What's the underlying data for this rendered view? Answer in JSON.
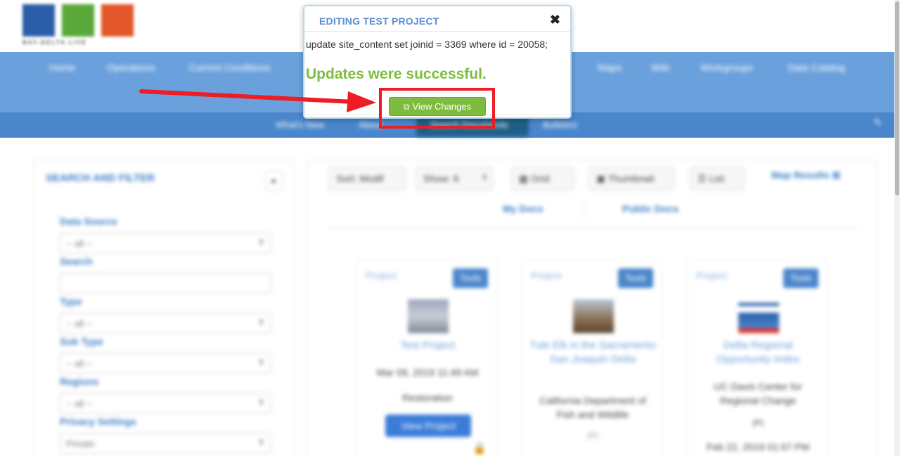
{
  "logo": {
    "tagline": "BAY-DELTA LIVE"
  },
  "navbar": {
    "items": [
      "Home",
      "Operations",
      "Current Conditions",
      "Maps",
      "Wiki",
      "Workgroups",
      "Data Catalog"
    ]
  },
  "subnav": {
    "items": [
      "What's New",
      "About",
      "Search Documents",
      "Bulletins"
    ]
  },
  "filter_panel": {
    "title": "SEARCH AND FILTER",
    "collapse": "▸",
    "fields": [
      {
        "label": "Data Source",
        "value": "-- all --"
      },
      {
        "label": "Search",
        "value": ""
      },
      {
        "label": "Type",
        "value": "-- all --"
      },
      {
        "label": "Sub Type",
        "value": "-- all --"
      },
      {
        "label": "Regions",
        "value": "-- all --"
      },
      {
        "label": "Privacy Settings",
        "value": "Private"
      }
    ]
  },
  "results": {
    "sort": "Sort: Modif",
    "show": "Show: 6",
    "views": [
      "Grid",
      "Thumbnail",
      "List"
    ],
    "map_link": "Map Results",
    "tabs": [
      "My Docs",
      "Public Docs"
    ],
    "cards": [
      {
        "type": "Project",
        "tools": "Tools",
        "title": "Test Project",
        "lines": [
          "Mar 09, 2019 11:49 AM",
          "Restoration"
        ],
        "button": "View Project"
      },
      {
        "type": "Project",
        "tools": "Tools",
        "title": "Tule Elk in the Sacramento San Joaquin Delta",
        "lines": [
          "California Department of Fish and Wildlife",
          "(P)"
        ],
        "button": ""
      },
      {
        "type": "Project",
        "tools": "Tools",
        "title": "Delta Regional Opportunity Index",
        "lines": [
          "UC Davis Center for Regional Change",
          "(P)",
          "Feb 22, 2019 01:07 PM"
        ],
        "button": ""
      }
    ]
  },
  "modal": {
    "title": "EDITING TEST PROJECT",
    "close": "✖",
    "sql": "update site_content set joinid = 3369 where id = 20058;",
    "success": "Updates were successful.",
    "view_changes": "View Changes"
  },
  "colors": {
    "accent_blue": "#5b8fd1",
    "success_green": "#7dbc3e",
    "annotation_red": "#ee1c24"
  }
}
